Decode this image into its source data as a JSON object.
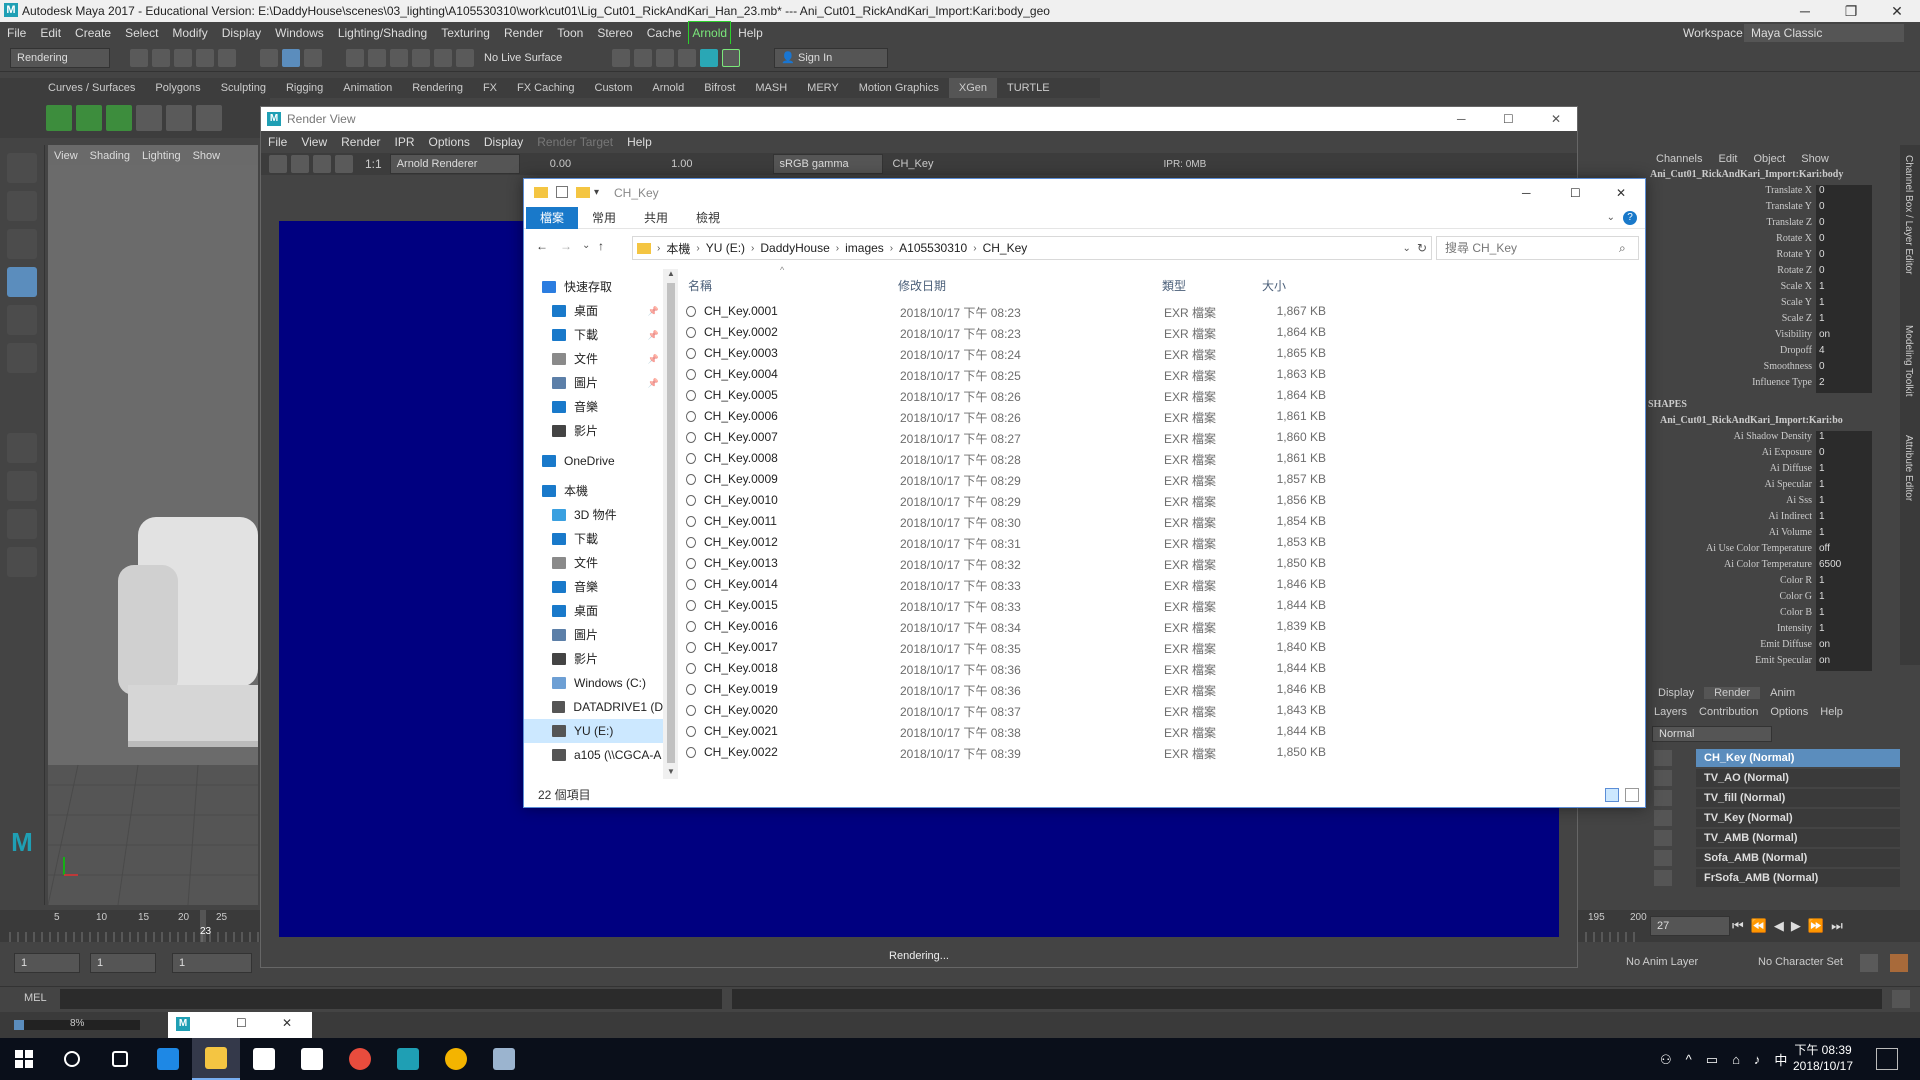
{
  "maya": {
    "title": "Autodesk Maya 2017 - Educational Version: E:\\DaddyHouse\\scenes\\03_lighting\\A105530310\\work\\cut01\\Lig_Cut01_RickAndKari_Han_23.mb*  ---  Ani_Cut01_RickAndKari_Import:Kari:body_geo",
    "menus": [
      "File",
      "Edit",
      "Create",
      "Select",
      "Modify",
      "Display",
      "Windows",
      "Lighting/Shading",
      "Texturing",
      "Render",
      "Toon",
      "Stereo",
      "Cache",
      "Arnold",
      "Help"
    ],
    "workspace_label": "Workspace :",
    "workspace_value": "Maya Classic",
    "mode_value": "Rendering",
    "live_surface": "No Live Surface",
    "sign_in": "Sign In",
    "shelf_tabs": [
      "Curves / Surfaces",
      "Polygons",
      "Sculpting",
      "Rigging",
      "Animation",
      "Rendering",
      "FX",
      "FX Caching",
      "Custom",
      "Arnold",
      "Bifrost",
      "MASH",
      "MERY",
      "Motion Graphics",
      "XGen",
      "TURTLE"
    ],
    "shelf_active": "XGen",
    "viewport_menu": [
      "View",
      "Shading",
      "Lighting",
      "Show"
    ],
    "timeline_ticks": [
      "5",
      "10",
      "15",
      "20",
      "25",
      "195",
      "200"
    ],
    "current_frame_marker": "23",
    "range_start": "1",
    "range_start2": "1",
    "range_slot": "1",
    "current_frame": "27",
    "anim_layer": "No Anim Layer",
    "character_set": "No Character Set",
    "mel_label": "MEL",
    "progress_pct": "8%"
  },
  "render_view": {
    "title": "Render View",
    "menus": [
      "File",
      "View",
      "Render",
      "IPR",
      "Options",
      "Display",
      "Render Target",
      "Help"
    ],
    "renderer": "Arnold Renderer",
    "exposure": "0.00",
    "gamma": "1.00",
    "color_space": "sRGB gamma",
    "layer": "CH_Key",
    "ipr": "IPR: 0MB",
    "ratio": "1:1",
    "status": "Rendering..."
  },
  "channel_box": {
    "menus": [
      "Channels",
      "Edit",
      "Object",
      "Show"
    ],
    "object_name": "Ani_Cut01_RickAndKari_Import:Kari:body",
    "attrs": [
      {
        "name": "Translate X",
        "value": "0"
      },
      {
        "name": "Translate Y",
        "value": "0"
      },
      {
        "name": "Translate Z",
        "value": "0"
      },
      {
        "name": "Rotate X",
        "value": "0"
      },
      {
        "name": "Rotate Y",
        "value": "0"
      },
      {
        "name": "Rotate Z",
        "value": "0"
      },
      {
        "name": "Scale X",
        "value": "1"
      },
      {
        "name": "Scale Y",
        "value": "1"
      },
      {
        "name": "Scale Z",
        "value": "1"
      },
      {
        "name": "Visibility",
        "value": "on"
      },
      {
        "name": "Dropoff",
        "value": "4"
      },
      {
        "name": "Smoothness",
        "value": "0"
      },
      {
        "name": "Influence Type",
        "value": "2"
      }
    ],
    "shapes_label": "SHAPES",
    "shape_name": "Ani_Cut01_RickAndKari_Import:Kari:bo",
    "shape_attrs": [
      {
        "name": "Ai Shadow Density",
        "value": "1"
      },
      {
        "name": "Ai Exposure",
        "value": "0"
      },
      {
        "name": "Ai Diffuse",
        "value": "1"
      },
      {
        "name": "Ai Specular",
        "value": "1"
      },
      {
        "name": "Ai Sss",
        "value": "1"
      },
      {
        "name": "Ai Indirect",
        "value": "1"
      },
      {
        "name": "Ai Volume",
        "value": "1"
      },
      {
        "name": "Ai Use Color Temperature",
        "value": "off"
      },
      {
        "name": "Ai Color Temperature",
        "value": "6500"
      },
      {
        "name": "Color R",
        "value": "1"
      },
      {
        "name": "Color G",
        "value": "1"
      },
      {
        "name": "Color B",
        "value": "1"
      },
      {
        "name": "Intensity",
        "value": "1"
      },
      {
        "name": "Emit Diffuse",
        "value": "on"
      },
      {
        "name": "Emit Specular",
        "value": "on"
      }
    ],
    "side_tabs": [
      "Channel Box / Layer Editor",
      "Modeling Toolkit",
      "Attribute Editor"
    ]
  },
  "layer_editor": {
    "tabs": [
      "Display",
      "Render",
      "Anim"
    ],
    "active_tab": "Render",
    "menus": [
      "Layers",
      "Contribution",
      "Options",
      "Help"
    ],
    "blend_mode": "Normal",
    "layers": [
      "CH_Key (Normal)",
      "TV_AO (Normal)",
      "TV_fill (Normal)",
      "TV_Key (Normal)",
      "TV_AMB (Normal)",
      "Sofa_AMB (Normal)",
      "FrSofa_AMB (Normal)"
    ]
  },
  "explorer": {
    "title": "CH_Key",
    "ribbon_tabs": [
      "檔案",
      "常用",
      "共用",
      "檢視"
    ],
    "breadcrumb": [
      "本機",
      "YU (E:)",
      "DaddyHouse",
      "images",
      "A105530310",
      "CH_Key"
    ],
    "search_placeholder": "搜尋 CH_Key",
    "nav": [
      {
        "label": "快速存取",
        "color": "#2b7de0",
        "indent": 18,
        "pinned": false
      },
      {
        "label": "桌面",
        "color": "#1979ca",
        "indent": 28,
        "pinned": true
      },
      {
        "label": "下載",
        "color": "#1979ca",
        "indent": 28,
        "pinned": true
      },
      {
        "label": "文件",
        "color": "#8a8a8a",
        "indent": 28,
        "pinned": true
      },
      {
        "label": "圖片",
        "color": "#5c7fa8",
        "indent": 28,
        "pinned": true
      },
      {
        "label": "音樂",
        "color": "#1979ca",
        "indent": 28,
        "pinned": false
      },
      {
        "label": "影片",
        "color": "#444444",
        "indent": 28,
        "pinned": false
      },
      {
        "label": "OneDrive",
        "color": "#1979ca",
        "indent": 18,
        "pinned": false
      },
      {
        "label": "本機",
        "color": "#1979ca",
        "indent": 18,
        "pinned": false
      },
      {
        "label": "3D 物件",
        "color": "#3aa0e0",
        "indent": 28,
        "pinned": false
      },
      {
        "label": "下載",
        "color": "#1979ca",
        "indent": 28,
        "pinned": false
      },
      {
        "label": "文件",
        "color": "#8a8a8a",
        "indent": 28,
        "pinned": false
      },
      {
        "label": "音樂",
        "color": "#1979ca",
        "indent": 28,
        "pinned": false
      },
      {
        "label": "桌面",
        "color": "#1979ca",
        "indent": 28,
        "pinned": false
      },
      {
        "label": "圖片",
        "color": "#5c7fa8",
        "indent": 28,
        "pinned": false
      },
      {
        "label": "影片",
        "color": "#444444",
        "indent": 28,
        "pinned": false
      },
      {
        "label": "Windows (C:)",
        "color": "#6d9fd4",
        "indent": 28,
        "pinned": false
      },
      {
        "label": "DATADRIVE1 (D",
        "color": "#555555",
        "indent": 28,
        "pinned": false
      },
      {
        "label": "YU (E:)",
        "color": "#555555",
        "indent": 28,
        "pinned": false,
        "selected": true
      },
      {
        "label": "a105 (\\\\CGCA-A",
        "color": "#555555",
        "indent": 28,
        "pinned": false
      }
    ],
    "columns": [
      "名稱",
      "修改日期",
      "類型",
      "大小"
    ],
    "files": [
      [
        "CH_Key.0001",
        "2018/10/17 下午 08:23",
        "EXR 檔案",
        "1,867 KB"
      ],
      [
        "CH_Key.0002",
        "2018/10/17 下午 08:23",
        "EXR 檔案",
        "1,864 KB"
      ],
      [
        "CH_Key.0003",
        "2018/10/17 下午 08:24",
        "EXR 檔案",
        "1,865 KB"
      ],
      [
        "CH_Key.0004",
        "2018/10/17 下午 08:25",
        "EXR 檔案",
        "1,863 KB"
      ],
      [
        "CH_Key.0005",
        "2018/10/17 下午 08:26",
        "EXR 檔案",
        "1,864 KB"
      ],
      [
        "CH_Key.0006",
        "2018/10/17 下午 08:26",
        "EXR 檔案",
        "1,861 KB"
      ],
      [
        "CH_Key.0007",
        "2018/10/17 下午 08:27",
        "EXR 檔案",
        "1,860 KB"
      ],
      [
        "CH_Key.0008",
        "2018/10/17 下午 08:28",
        "EXR 檔案",
        "1,861 KB"
      ],
      [
        "CH_Key.0009",
        "2018/10/17 下午 08:29",
        "EXR 檔案",
        "1,857 KB"
      ],
      [
        "CH_Key.0010",
        "2018/10/17 下午 08:29",
        "EXR 檔案",
        "1,856 KB"
      ],
      [
        "CH_Key.0011",
        "2018/10/17 下午 08:30",
        "EXR 檔案",
        "1,854 KB"
      ],
      [
        "CH_Key.0012",
        "2018/10/17 下午 08:31",
        "EXR 檔案",
        "1,853 KB"
      ],
      [
        "CH_Key.0013",
        "2018/10/17 下午 08:32",
        "EXR 檔案",
        "1,850 KB"
      ],
      [
        "CH_Key.0014",
        "2018/10/17 下午 08:33",
        "EXR 檔案",
        "1,846 KB"
      ],
      [
        "CH_Key.0015",
        "2018/10/17 下午 08:33",
        "EXR 檔案",
        "1,844 KB"
      ],
      [
        "CH_Key.0016",
        "2018/10/17 下午 08:34",
        "EXR 檔案",
        "1,839 KB"
      ],
      [
        "CH_Key.0017",
        "2018/10/17 下午 08:35",
        "EXR 檔案",
        "1,840 KB"
      ],
      [
        "CH_Key.0018",
        "2018/10/17 下午 08:36",
        "EXR 檔案",
        "1,844 KB"
      ],
      [
        "CH_Key.0019",
        "2018/10/17 下午 08:36",
        "EXR 檔案",
        "1,846 KB"
      ],
      [
        "CH_Key.0020",
        "2018/10/17 下午 08:37",
        "EXR 檔案",
        "1,843 KB"
      ],
      [
        "CH_Key.0021",
        "2018/10/17 下午 08:38",
        "EXR 檔案",
        "1,844 KB"
      ],
      [
        "CH_Key.0022",
        "2018/10/17 下午 08:39",
        "EXR 檔案",
        "1,850 KB"
      ]
    ],
    "item_count": "22 個項目"
  },
  "taskbar": {
    "time": "下午 08:39",
    "date": "2018/10/17",
    "ime": "中",
    "apps": [
      {
        "name": "search-icon",
        "color": "#ffffff"
      },
      {
        "name": "task-view-icon",
        "color": "#ffffff"
      },
      {
        "name": "edge-icon",
        "color": "#1e88e5"
      },
      {
        "name": "file-explorer-icon",
        "color": "#f4c542"
      },
      {
        "name": "store-icon",
        "color": "#ffffff"
      },
      {
        "name": "mail-icon",
        "color": "#ffffff"
      },
      {
        "name": "chrome-icon",
        "color": "#e84c3d"
      },
      {
        "name": "maya-icon",
        "color": "#1f9fb4"
      },
      {
        "name": "nuke-icon",
        "color": "#f4b400"
      },
      {
        "name": "app-icon",
        "color": "#9bb4cf"
      }
    ]
  },
  "colors": {
    "render_bg": "#000080",
    "accent": "#1979ca",
    "layer_selected": "#5b8dbd"
  }
}
